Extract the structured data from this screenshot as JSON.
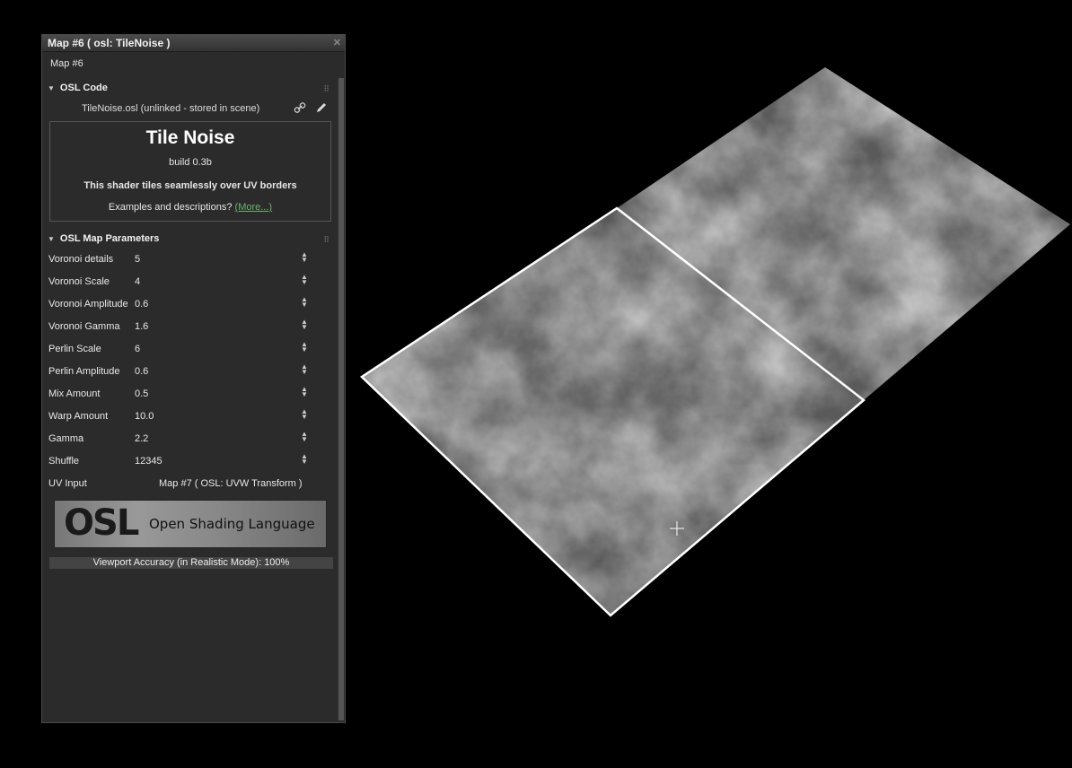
{
  "panel": {
    "title": "Map #6  ( osl: TileNoise )",
    "close_label": "✕",
    "map_name": "Map #6",
    "osl_code_header": "OSL Code",
    "file_line": "TileNoise.osl (unlinked - stored in scene)",
    "info": {
      "title": "Tile Noise",
      "build": "build 0.3b",
      "description": "This shader tiles seamlessly over UV borders",
      "examples_text": "Examples and descriptions? ",
      "more_link": "(More...)"
    },
    "params_header": "OSL Map Parameters",
    "params": [
      {
        "label": "Voronoi details",
        "value": "5"
      },
      {
        "label": "Voronoi Scale",
        "value": "4"
      },
      {
        "label": "Voronoi Amplitude",
        "value": "0.6"
      },
      {
        "label": "Voronoi Gamma",
        "value": "1.6"
      },
      {
        "label": "Perlin Scale",
        "value": "6"
      },
      {
        "label": "Perlin Amplitude",
        "value": "0.6"
      },
      {
        "label": "Mix Amount",
        "value": "0.5"
      },
      {
        "label": "Warp Amount",
        "value": "10.0"
      },
      {
        "label": "Gamma",
        "value": "2.2"
      },
      {
        "label": "Shuffle",
        "value": "12345"
      }
    ],
    "uv_input": {
      "label": "UV Input",
      "value": "Map #7  ( OSL: UVW Transform )"
    },
    "banner": {
      "logo": "OSL",
      "text": "Open Shading Language"
    },
    "accuracy": "Viewport Accuracy (in Realistic Mode): 100%"
  },
  "colors": {
    "link": "#6bb36b",
    "panel_bg": "#2b2b2b",
    "viewport_bg": "#000000"
  },
  "icons": [
    "link-icon",
    "pencil-icon",
    "crosshair-cursor-icon"
  ]
}
